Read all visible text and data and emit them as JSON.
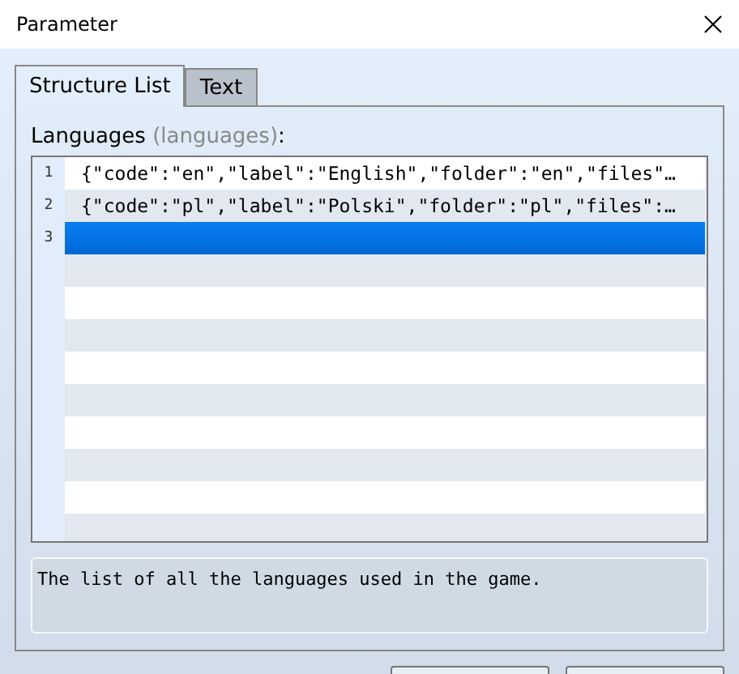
{
  "window": {
    "title": "Parameter"
  },
  "tabs": [
    {
      "label": "Structure List",
      "selected": true
    },
    {
      "label": "Text",
      "selected": false
    }
  ],
  "field": {
    "label": "Languages",
    "key": "(languages)",
    "suffix": ":"
  },
  "rows": [
    {
      "number": "1",
      "text": "{\"code\":\"en\",\"label\":\"English\",\"folder\":\"en\",\"files\"…",
      "selected": false
    },
    {
      "number": "2",
      "text": "{\"code\":\"pl\",\"label\":\"Polski\",\"folder\":\"pl\",\"files\":…",
      "selected": false
    },
    {
      "number": "3",
      "selected": true
    }
  ],
  "description": "The list of all the languages used in the game."
}
